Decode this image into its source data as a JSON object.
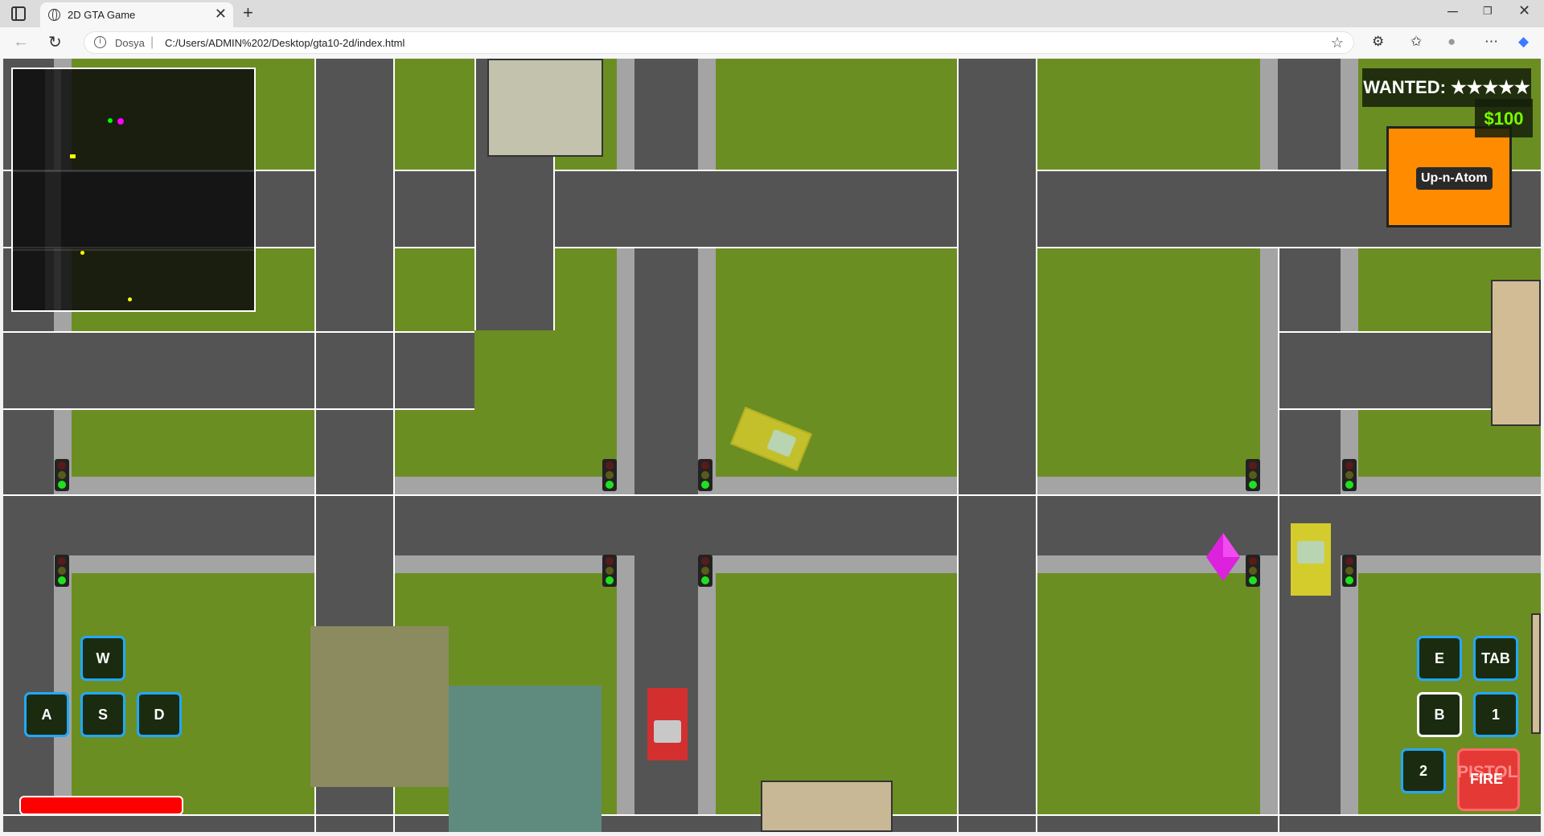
{
  "browser": {
    "tab_title": "2D GTA Game",
    "tab_close": "✕",
    "new_tab": "+",
    "url_scheme": "Dosya",
    "url": "C:/Users/ADMIN%202/Desktop/gta10-2d/index.html",
    "window_controls": {
      "minimize": "─",
      "maximize": "❐",
      "close": "✕"
    }
  },
  "hud": {
    "wanted_label": "WANTED: ★★★★★",
    "money": "$100",
    "shop_name": "Up-n-Atom",
    "weapon": "PISTOL",
    "fire_label": "FIRE",
    "health_fraction": 1.0,
    "colors": {
      "health": "#ff0000",
      "money": "#77ff00",
      "shop": "#ff8c00",
      "key_border": "#22a8ff"
    }
  },
  "controls": {
    "w": "W",
    "a": "A",
    "s": "S",
    "d": "D",
    "e": "E",
    "tab": "TAB",
    "b": "B",
    "one": "1",
    "two": "2"
  },
  "minimap": {
    "colors": {
      "player": "#ff00ff",
      "mission": "#00ff00",
      "car": "#ffff00"
    }
  },
  "icons": {
    "back": "←",
    "reload": "↻",
    "info": "i",
    "star": "☆",
    "extensions": "⚙",
    "favorites": "✩",
    "profile": "●",
    "more": "⋯",
    "copilot": "◆"
  }
}
